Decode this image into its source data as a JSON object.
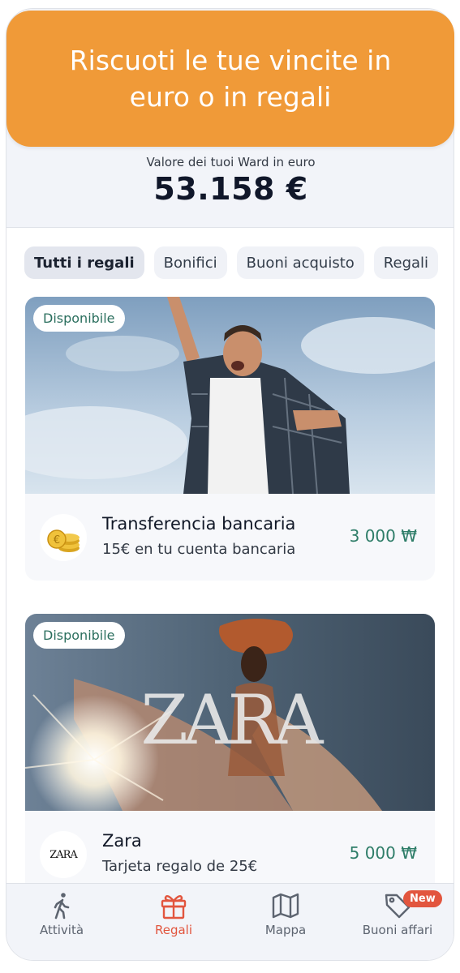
{
  "banner": {
    "text": "Riscuoti le tue vincite in euro o in regali"
  },
  "summary": {
    "label": "Valore dei tuoi Ward in euro",
    "value": "53.158 €"
  },
  "filters": [
    {
      "label": "Tutti i regali",
      "active": true
    },
    {
      "label": "Bonifici",
      "active": false
    },
    {
      "label": "Buoni acquisto",
      "active": false
    },
    {
      "label": "Regali",
      "active": false
    }
  ],
  "rewards": [
    {
      "badge": "Disponibile",
      "title": "Transferencia bancaria",
      "subtitle": "15€ en tu cuenta bancaria",
      "price": "3 000 ₩",
      "icon": "coins-icon"
    },
    {
      "badge": "Disponibile",
      "title": "Zara",
      "subtitle": "Tarjeta regalo de 25€",
      "price": "5 000 ₩",
      "icon": "zara-logo",
      "logo_text": "ZARA",
      "icon_text": "ZARA"
    }
  ],
  "tabbar": {
    "items": [
      {
        "label": "Attività",
        "icon": "walking-person-icon",
        "active": false
      },
      {
        "label": "Regali",
        "icon": "gift-icon",
        "active": true
      },
      {
        "label": "Mappa",
        "icon": "map-icon",
        "active": false
      },
      {
        "label": "Buoni affari",
        "icon": "tag-icon",
        "active": false,
        "badge": "New"
      }
    ]
  },
  "colors": {
    "accent": "#f09a38",
    "active_tab": "#e2553e",
    "price": "#2e7d68"
  }
}
